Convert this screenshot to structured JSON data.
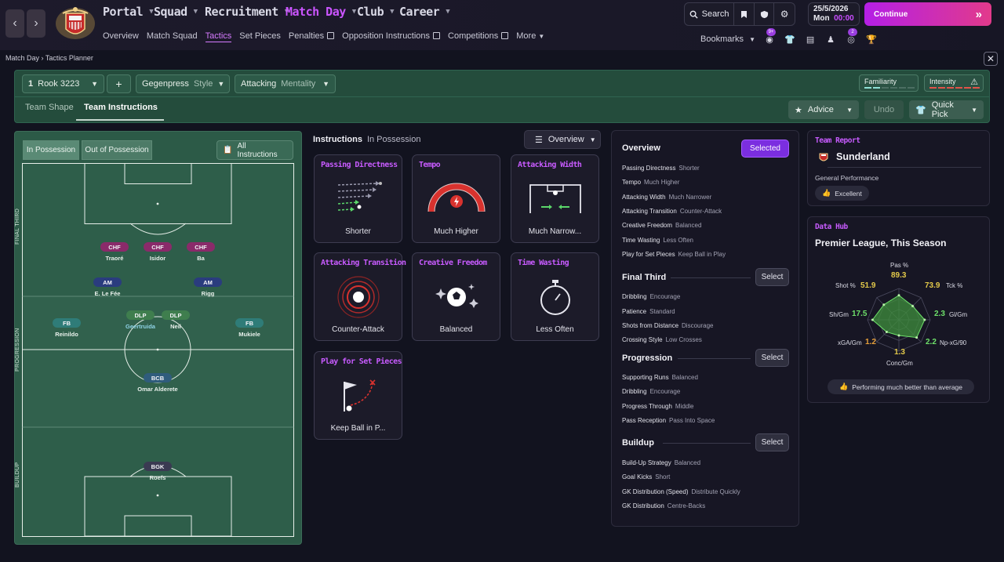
{
  "nav": {
    "back_icon": "chevron-left-icon",
    "forward_icon": "chevron-right-icon"
  },
  "main_menu": [
    "Portal",
    "Squad",
    "Recruitment",
    "Match Day",
    "Club",
    "Career"
  ],
  "sub_menu": [
    "Overview",
    "Match Squad",
    "Tactics",
    "Set Pieces",
    "Penalties",
    "Opposition Instructions",
    "Competitions",
    "More"
  ],
  "top": {
    "search_label": "Search",
    "date": "25/5/2026",
    "day": "Mon",
    "time": "00:00",
    "continue_label": "Continue",
    "bookmarks_label": "Bookmarks",
    "badge_1": "9+",
    "badge_2": "2"
  },
  "breadcrumb": {
    "root": "Match Day",
    "current": "Tactics Planner"
  },
  "tactic": {
    "number": "1",
    "name": "Rook 3223",
    "style_value": "Gegenpress",
    "style_label": "Style",
    "mentality_value": "Attacking",
    "mentality_label": "Mentality",
    "familiarity_label": "Familiarity",
    "intensity_label": "Intensity"
  },
  "tabs": {
    "team_shape": "Team Shape",
    "team_instructions": "Team Instructions"
  },
  "actions": {
    "advice": "Advice",
    "undo": "Undo",
    "quick_pick": "Quick Pick"
  },
  "pitch": {
    "in_possession": "In Possession",
    "out_of_possession": "Out of Possession",
    "all_instructions": "All Instructions",
    "zones": {
      "final_third": "FINAL THIRD",
      "progression": "PROGRESSION",
      "buildup": "BUILDUP"
    },
    "players": [
      {
        "role": "CHF",
        "name": "Traoré"
      },
      {
        "role": "CHF",
        "name": "Isidor"
      },
      {
        "role": "CHF",
        "name": "Ba"
      },
      {
        "role": "AM",
        "name": "E. Le Fée"
      },
      {
        "role": "AM",
        "name": "Rigg"
      },
      {
        "role": "FB",
        "name": "Reinildo"
      },
      {
        "role": "DLP",
        "name": "Geertruida"
      },
      {
        "role": "DLP",
        "name": "Neil"
      },
      {
        "role": "FB",
        "name": "Mukiele"
      },
      {
        "role": "BCB",
        "name": "Omar Alderete"
      },
      {
        "role": "BGK",
        "name": "Roefs"
      }
    ]
  },
  "instructions": {
    "title": "Instructions",
    "subtitle": "In Possession",
    "view_select": "Overview",
    "cards": [
      {
        "title": "Passing Directness",
        "value": "Shorter"
      },
      {
        "title": "Tempo",
        "value": "Much Higher"
      },
      {
        "title": "Attacking Width",
        "value": "Much Narrow..."
      },
      {
        "title": "Attacking Transition",
        "value": "Counter-Attack"
      },
      {
        "title": "Creative Freedom",
        "value": "Balanced"
      },
      {
        "title": "Time Wasting",
        "value": "Less Often"
      },
      {
        "title": "Play for Set Pieces",
        "value": "Keep Ball in P..."
      }
    ]
  },
  "overview": {
    "sections": [
      {
        "title": "Overview",
        "button": "Selected",
        "rows": [
          {
            "k": "Passing Directness",
            "v": "Shorter"
          },
          {
            "k": "Tempo",
            "v": "Much Higher"
          },
          {
            "k": "Attacking Width",
            "v": "Much Narrower"
          },
          {
            "k": "Attacking Transition",
            "v": "Counter-Attack"
          },
          {
            "k": "Creative Freedom",
            "v": "Balanced"
          },
          {
            "k": "Time Wasting",
            "v": "Less Often"
          },
          {
            "k": "Play for Set Pieces",
            "v": "Keep Ball in Play"
          }
        ]
      },
      {
        "title": "Final Third",
        "button": "Select",
        "rows": [
          {
            "k": "Dribbling",
            "v": "Encourage"
          },
          {
            "k": "Patience",
            "v": "Standard"
          },
          {
            "k": "Shots from Distance",
            "v": "Discourage"
          },
          {
            "k": "Crossing Style",
            "v": "Low Crosses"
          }
        ]
      },
      {
        "title": "Progression",
        "button": "Select",
        "rows": [
          {
            "k": "Supporting Runs",
            "v": "Balanced"
          },
          {
            "k": "Dribbling",
            "v": "Encourage"
          },
          {
            "k": "Progress Through",
            "v": "Middle"
          },
          {
            "k": "Pass Reception",
            "v": "Pass Into Space"
          }
        ]
      },
      {
        "title": "Buildup",
        "button": "Select",
        "rows": [
          {
            "k": "Build-Up Strategy",
            "v": "Balanced"
          },
          {
            "k": "Goal Kicks",
            "v": "Short"
          },
          {
            "k": "GK Distribution (Speed)",
            "v": "Distribute Quickly"
          },
          {
            "k": "GK Distribution",
            "v": "Centre-Backs"
          }
        ]
      }
    ]
  },
  "team_report": {
    "title": "Team Report",
    "team": "Sunderland",
    "label": "General Performance",
    "rating": "Excellent"
  },
  "data_hub": {
    "title": "Data Hub",
    "subtitle": "Premier League, This Season",
    "footer": "Performing much better than average",
    "positive_color": "#6ee06a",
    "neutral_color": "#e3c94a",
    "negative_color": "#e8a03a",
    "stats": [
      {
        "label": "Pas %",
        "value": "89.3",
        "level": 0.78
      },
      {
        "label": "Tck %",
        "value": "73.9",
        "level": 0.62
      },
      {
        "label": "Gl/Gm",
        "value": "2.3",
        "level": 0.82
      },
      {
        "label": "Np-xG/90",
        "value": "2.2",
        "level": 0.8
      },
      {
        "label": "Conc/Gm",
        "value": "1.3",
        "level": 0.5
      },
      {
        "label": "xGA/Gm",
        "value": "1.2",
        "level": 0.55
      },
      {
        "label": "Sh/Gm",
        "value": "17.5",
        "level": 0.84
      },
      {
        "label": "Shot %",
        "value": "51.9",
        "level": 0.68
      }
    ]
  }
}
